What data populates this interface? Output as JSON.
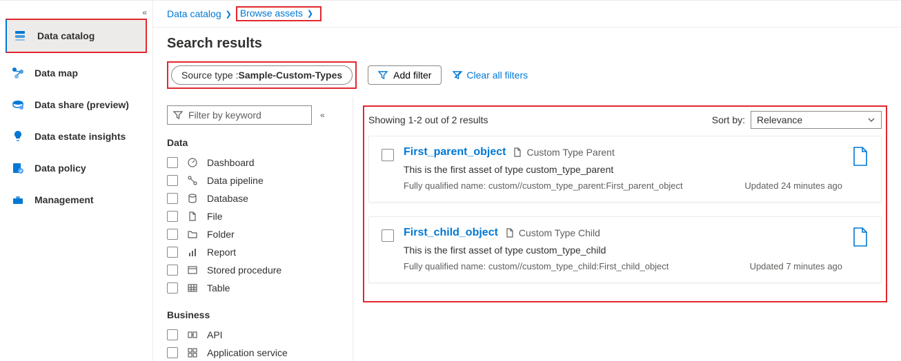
{
  "nav": {
    "items": [
      {
        "label": "Data catalog"
      },
      {
        "label": "Data map"
      },
      {
        "label": "Data share (preview)"
      },
      {
        "label": "Data estate insights"
      },
      {
        "label": "Data policy"
      },
      {
        "label": "Management"
      }
    ]
  },
  "breadcrumb": {
    "root": "Data catalog",
    "current": "Browse assets"
  },
  "page_title": "Search results",
  "filter_bar": {
    "pill_label": "Source type : ",
    "pill_value": "Sample-Custom-Types",
    "add_filter": "Add filter",
    "clear_all": "Clear all filters"
  },
  "filter_panel": {
    "search_placeholder": "Filter by keyword",
    "sections": [
      {
        "title": "Data",
        "facets": [
          {
            "label": "Dashboard"
          },
          {
            "label": "Data pipeline"
          },
          {
            "label": "Database"
          },
          {
            "label": "File"
          },
          {
            "label": "Folder"
          },
          {
            "label": "Report"
          },
          {
            "label": "Stored procedure"
          },
          {
            "label": "Table"
          }
        ]
      },
      {
        "title": "Business",
        "facets": [
          {
            "label": "API"
          },
          {
            "label": "Application service"
          }
        ]
      }
    ]
  },
  "results": {
    "summary": "Showing 1-2 out of 2 results",
    "sort_label": "Sort by:",
    "sort_value": "Relevance",
    "items": [
      {
        "title": "First_parent_object",
        "type_label": "Custom Type Parent",
        "description": "This is the first asset of type custom_type_parent",
        "fqn": "Fully qualified name: custom//custom_type_parent:First_parent_object",
        "updated": "Updated 24 minutes ago"
      },
      {
        "title": "First_child_object",
        "type_label": "Custom Type Child",
        "description": "This is the first asset of type custom_type_child",
        "fqn": "Fully qualified name: custom//custom_type_child:First_child_object",
        "updated": "Updated 7 minutes ago"
      }
    ]
  }
}
